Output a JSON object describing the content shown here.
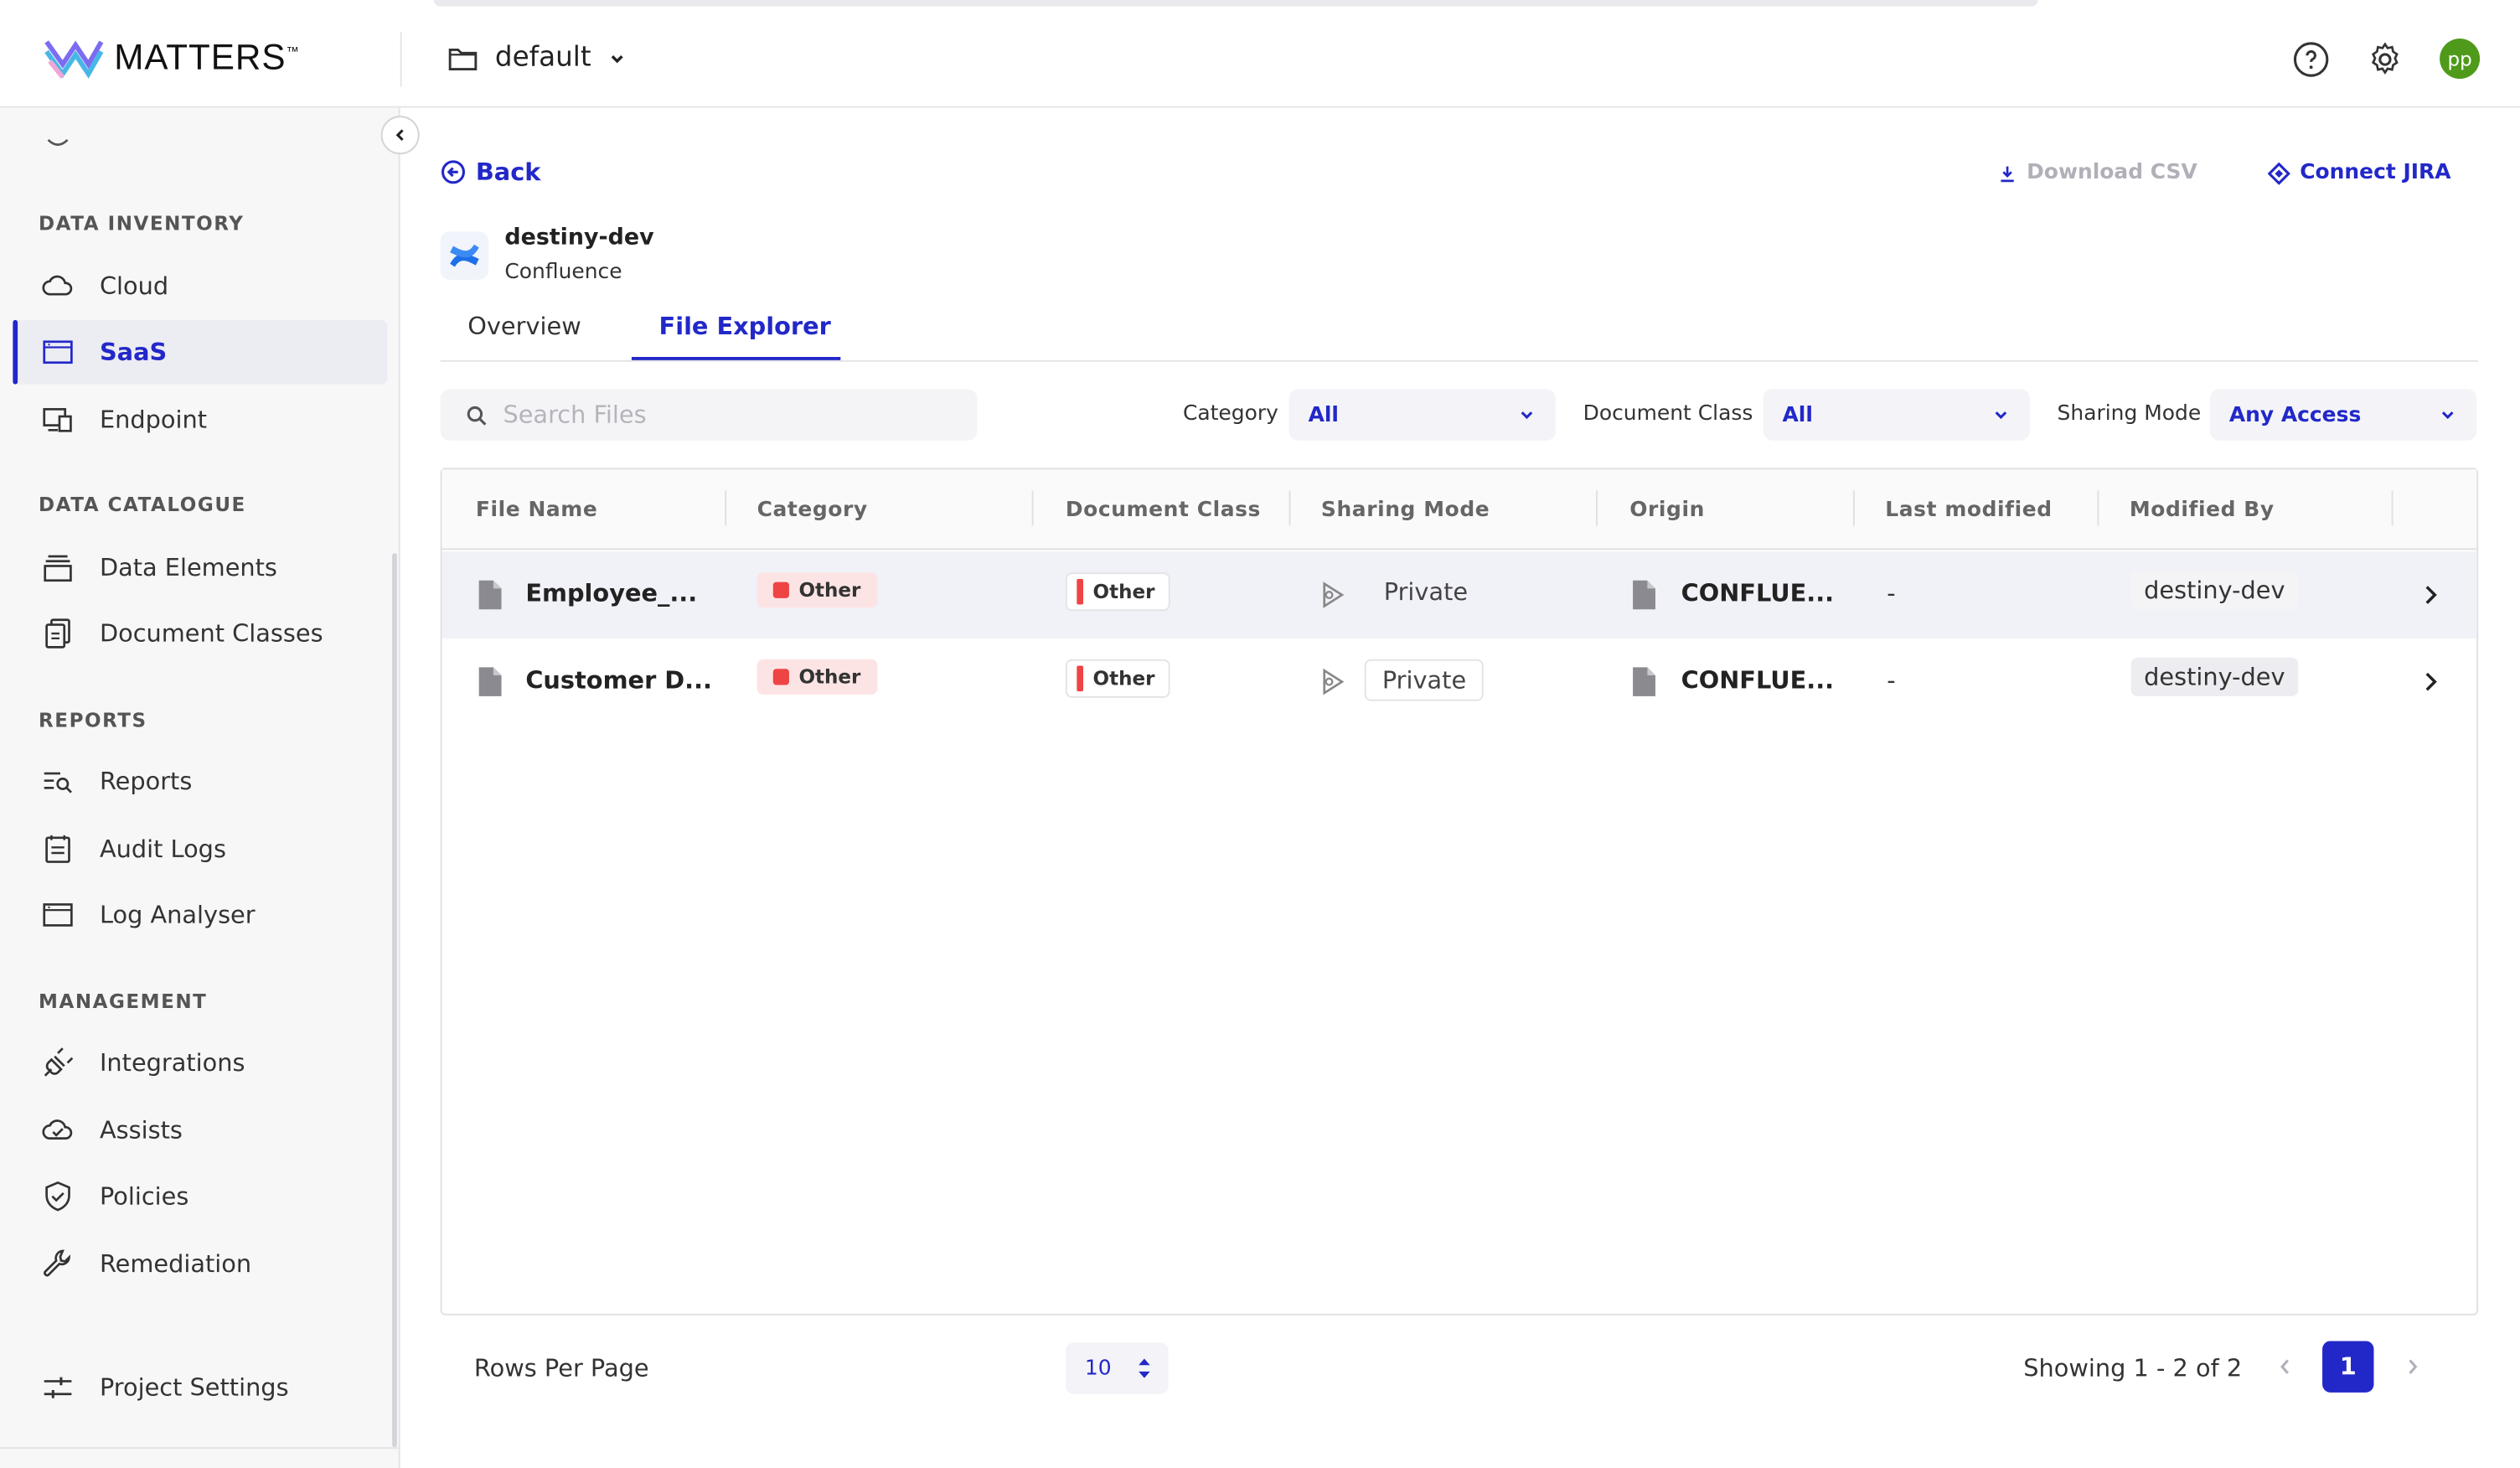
{
  "brand": {
    "name": "MATTERS",
    "tm": "™"
  },
  "workspace": {
    "name": "default"
  },
  "header": {
    "avatar_initials": "pp"
  },
  "sidebar": {
    "sections": [
      {
        "title": "DATA INVENTORY",
        "items": [
          {
            "label": "Cloud",
            "icon": "cloud-icon"
          },
          {
            "label": "SaaS",
            "icon": "window-icon",
            "active": true
          },
          {
            "label": "Endpoint",
            "icon": "devices-icon"
          }
        ]
      },
      {
        "title": "DATA CATALOGUE",
        "items": [
          {
            "label": "Data Elements",
            "icon": "layers-icon"
          },
          {
            "label": "Document Classes",
            "icon": "documents-icon"
          }
        ]
      },
      {
        "title": "REPORTS",
        "items": [
          {
            "label": "Reports",
            "icon": "report-search-icon"
          },
          {
            "label": "Audit Logs",
            "icon": "calendar-icon"
          },
          {
            "label": "Log Analyser",
            "icon": "window-icon"
          }
        ]
      },
      {
        "title": "MANAGEMENT",
        "items": [
          {
            "label": "Integrations",
            "icon": "plug-icon"
          },
          {
            "label": "Assists",
            "icon": "cloud-check-icon"
          },
          {
            "label": "Policies",
            "icon": "shield-check-icon"
          },
          {
            "label": "Remediation",
            "icon": "wrench-icon"
          }
        ]
      }
    ],
    "footer_item": {
      "label": "Project Settings",
      "icon": "sliders-icon"
    }
  },
  "page": {
    "back_label": "Back",
    "download_label": "Download CSV",
    "jira_label": "Connect JIRA",
    "source_name": "destiny-dev",
    "source_type": "Confluence",
    "tabs": [
      {
        "label": "Overview"
      },
      {
        "label": "File Explorer",
        "active": true
      }
    ]
  },
  "filters": {
    "search_placeholder": "Search Files",
    "category_label": "Category",
    "category_value": "All",
    "docclass_label": "Document Class",
    "docclass_value": "All",
    "sharing_label": "Sharing Mode",
    "sharing_value": "Any Access"
  },
  "table": {
    "columns": [
      "File Name",
      "Category",
      "Document Class",
      "Sharing Mode",
      "Origin",
      "Last modified",
      "Modified By"
    ],
    "rows": [
      {
        "file_name": "Employee_...",
        "category": "Other",
        "document_class": "Other",
        "sharing_mode": "Private",
        "origin": "CONFLUE...",
        "last_modified": "-",
        "modified_by": "destiny-dev"
      },
      {
        "file_name": "Customer D...",
        "category": "Other",
        "document_class": "Other",
        "sharing_mode": "Private",
        "origin": "CONFLUE...",
        "last_modified": "-",
        "modified_by": "destiny-dev"
      }
    ]
  },
  "pagination": {
    "rows_per_page_label": "Rows Per Page",
    "rows_per_page_value": "10",
    "showing_text": "Showing 1 - 2 of 2",
    "current_page": "1"
  },
  "colors": {
    "accent": "#2228c8",
    "danger": "#ef4444",
    "avatar": "#4f9a1a"
  }
}
